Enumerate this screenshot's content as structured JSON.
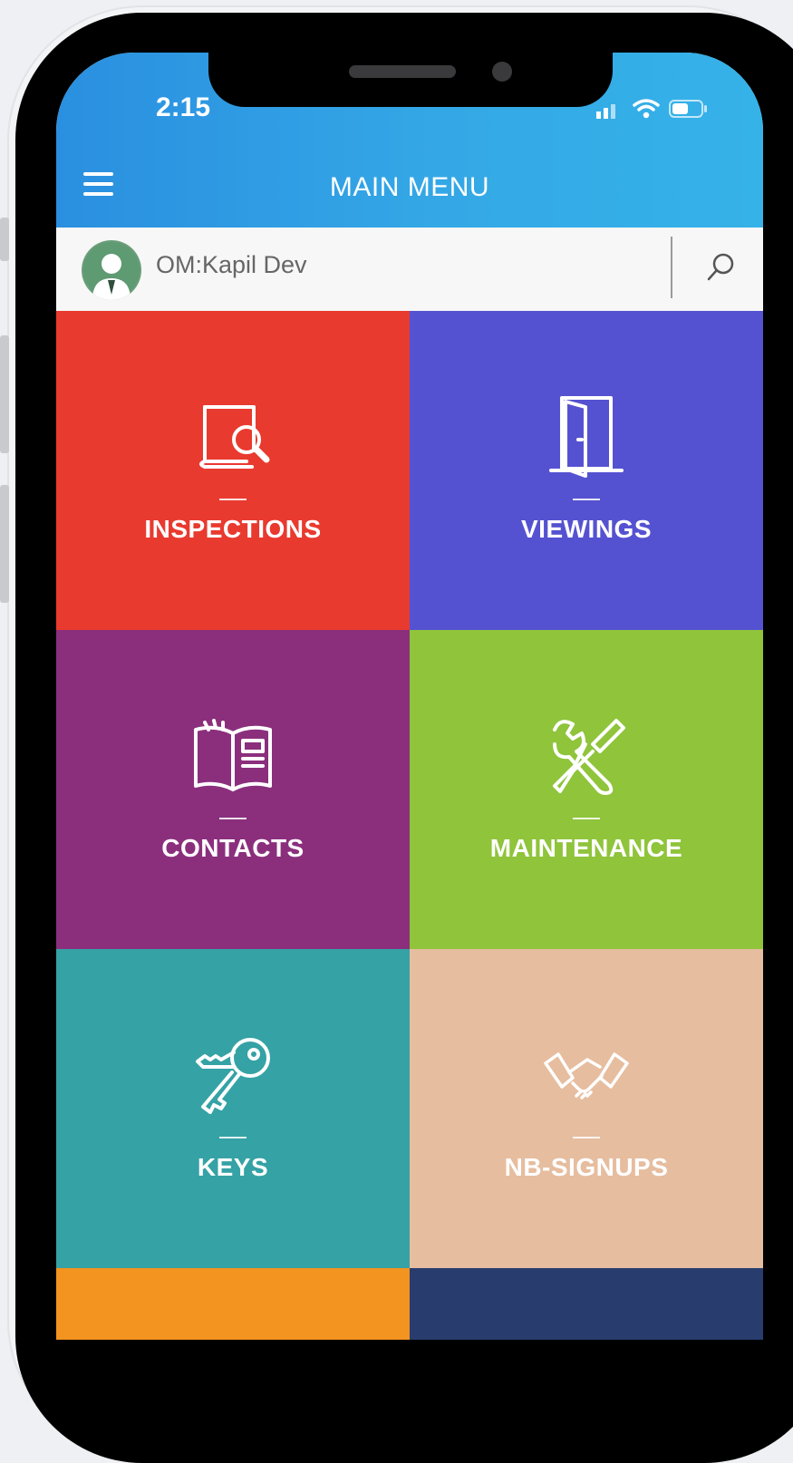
{
  "status_bar": {
    "time": "2:15"
  },
  "header": {
    "title": "MAIN MENU"
  },
  "user": {
    "name": "OM:Kapil Dev"
  },
  "tiles": [
    {
      "label": "INSPECTIONS",
      "icon": "book-search-icon",
      "color": "#e93a2f"
    },
    {
      "label": "VIEWINGS",
      "icon": "open-door-icon",
      "color": "#5552d1"
    },
    {
      "label": "CONTACTS",
      "icon": "open-book-icon",
      "color": "#8b2f7d"
    },
    {
      "label": "MAINTENANCE",
      "icon": "wrench-screwdriver-icon",
      "color": "#8fc43b"
    },
    {
      "label": "KEYS",
      "icon": "keys-icon",
      "color": "#35a2a5"
    },
    {
      "label": "NB-SIGNUPS",
      "icon": "handshake-icon",
      "color": "#e6bd9f"
    },
    {
      "label": "",
      "icon": "",
      "color": "#f39320"
    },
    {
      "label": "",
      "icon": "",
      "color": "#283d6e"
    }
  ],
  "colors": {
    "header_gradient_start": "#2a8fe0",
    "header_gradient_end": "#35b2e8",
    "phone_frame": "#000000"
  }
}
